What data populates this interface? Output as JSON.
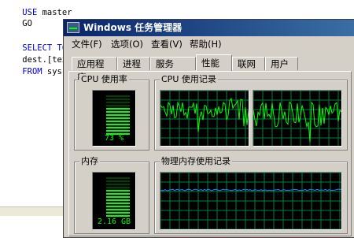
{
  "editor": {
    "lines": [
      {
        "kw": "USE",
        "rest": " master"
      },
      {
        "kw": "",
        "rest": "GO"
      },
      {
        "kw": "",
        "rest": ""
      },
      {
        "kw": "SELECT TOP",
        "rest": ""
      },
      {
        "kw": "",
        "rest": "dest.[text]"
      },
      {
        "kw": "FROM",
        "rest": " sys.[d"
      }
    ]
  },
  "window": {
    "title": "Windows 任务管理器",
    "menu": [
      "文件(F)",
      "选项(O)",
      "查看(V)",
      "帮助(H)"
    ],
    "tabs": [
      "应用程序",
      "进程",
      "服务",
      "性能",
      "联网",
      "用户"
    ],
    "active_tab": "性能"
  },
  "performance": {
    "cpu_usage_label": "CPU 使用率",
    "cpu_usage_value": "73 %",
    "cpu_usage_fraction": 0.73,
    "cpu_history_label": "CPU 使用记录",
    "memory_label": "内存",
    "memory_value": "2.16 GB",
    "memory_fraction": 0.72,
    "memory_history_label": "物理内存使用记录"
  },
  "colors": {
    "graph_bg": "#000000",
    "grid": "#008040",
    "trace": "#00ff00",
    "memory_trace": "#2a7fff",
    "titlebar": "#0a246a"
  }
}
